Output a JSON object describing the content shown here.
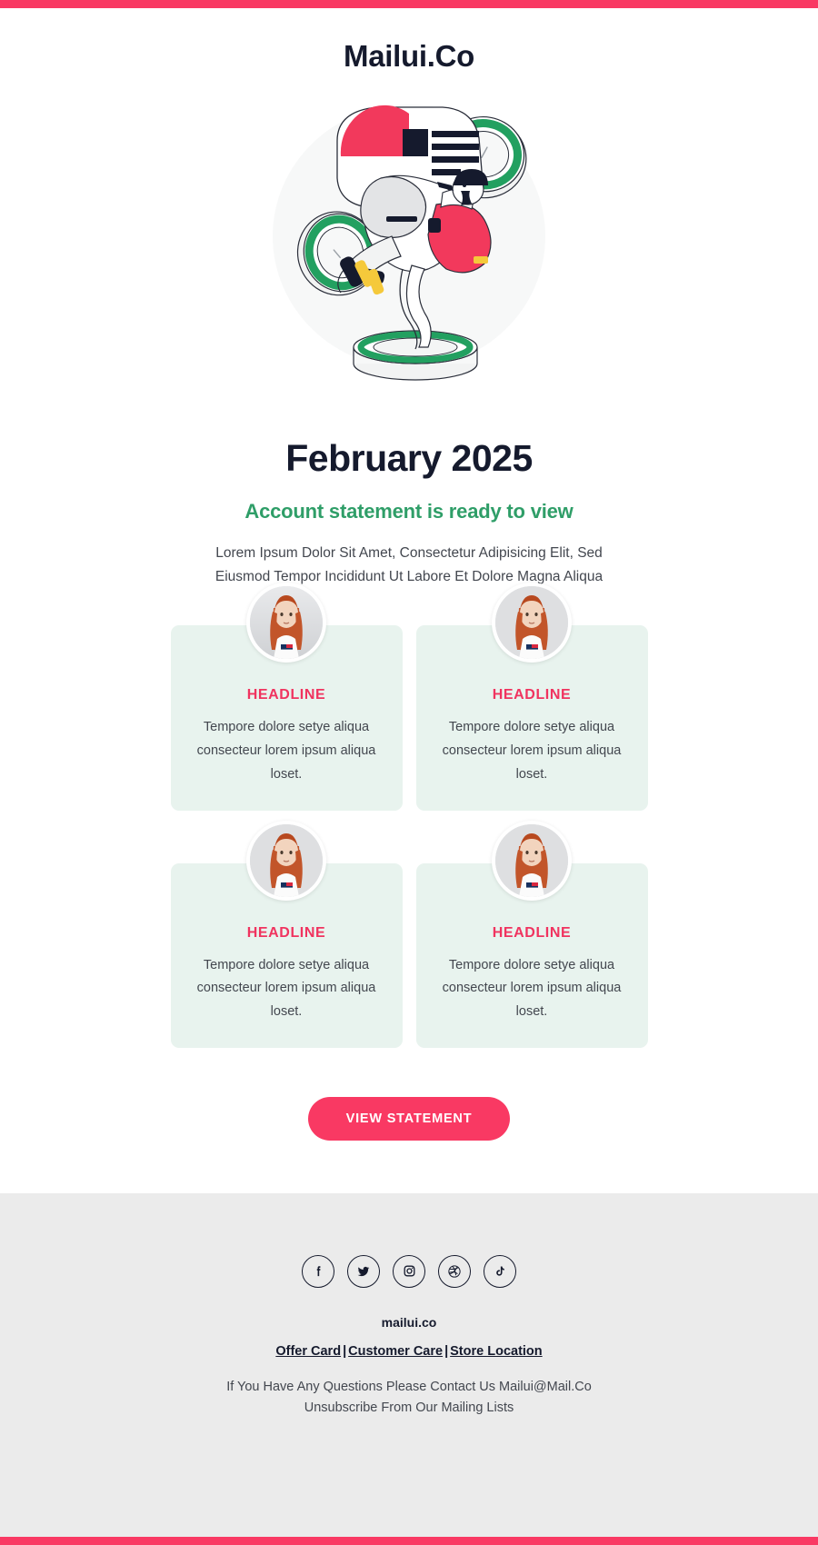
{
  "colors": {
    "accent_pink": "#F93963",
    "accent_green": "#2F9E68",
    "dark_navy": "#151A2D",
    "card_bg": "#E8F3EE",
    "footer_bg": "#EBEBEB",
    "headline_pink": "#F0335F"
  },
  "header": {
    "brand": "Mailui.Co"
  },
  "hero": {
    "illustration_name": "person-balancing-on-rings-illustration"
  },
  "main": {
    "month_title": "February 2025",
    "sub_title": "Account statement is ready to view",
    "intro_text": "Lorem Ipsum Dolor Sit Amet, Consectetur Adipisicing Elit, Sed Eiusmod Tempor Incididunt Ut Labore Et Dolore Magna Aliqua",
    "cards": [
      {
        "headline": "HEADLINE",
        "text": "Tempore dolore setye aliqua consecteur lorem ipsum aliqua loset.",
        "avatar": "woman-portrait-avatar"
      },
      {
        "headline": "HEADLINE",
        "text": "Tempore dolore setye aliqua consecteur lorem ipsum aliqua loset.",
        "avatar": "woman-portrait-avatar"
      },
      {
        "headline": "HEADLINE",
        "text": "Tempore dolore setye aliqua consecteur lorem ipsum aliqua loset.",
        "avatar": "woman-portrait-avatar"
      },
      {
        "headline": "HEADLINE",
        "text": "Tempore dolore setye aliqua consecteur lorem ipsum aliqua loset.",
        "avatar": "woman-portrait-avatar"
      }
    ],
    "cta_label": "VIEW STATEMENT"
  },
  "footer": {
    "socials": [
      {
        "name": "facebook-icon",
        "glyph": "f"
      },
      {
        "name": "twitter-icon",
        "glyph": "t"
      },
      {
        "name": "instagram-icon",
        "glyph": "i"
      },
      {
        "name": "dribbble-icon",
        "glyph": "d"
      },
      {
        "name": "tiktok-icon",
        "glyph": "k"
      }
    ],
    "brand": "mailui.co",
    "links": [
      "Offer Card",
      "Customer Care",
      "Store Location"
    ],
    "separator": "|",
    "note_line1": "If You Have Any Questions Please Contact Us Mailui@Mail.Co",
    "note_line2": "Unsubscribe From Our Mailing Lists"
  }
}
